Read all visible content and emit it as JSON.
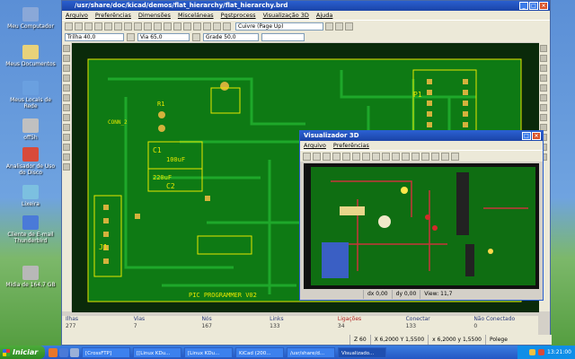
{
  "desktop_icons": [
    {
      "label": "Meu Computador",
      "color": "#8aa8d8"
    },
    {
      "label": "Meus Documentos",
      "color": "#e8d27a"
    },
    {
      "label": "Meus Locais de Rede",
      "color": "#6aa0e0"
    },
    {
      "label": "off5h",
      "color": "#c0c0c0"
    },
    {
      "label": "Analisador de Uso do Disco",
      "color": "#d84a3a"
    },
    {
      "label": "Lixeira",
      "color": "#7cc0e0"
    },
    {
      "label": "Cliente de E-mail Thunderbird",
      "color": "#4a7ad8"
    },
    {
      "label": "Mídia de 164,7 GB",
      "color": "#b8b8b8"
    }
  ],
  "main_window": {
    "title": "/usr/share/doc/kicad/demos/flat_hierarchy/flat_hierarchy.brd",
    "menu": [
      "Arquivo",
      "Preferências",
      "Dimensões",
      "Misceláneas",
      "Pqstprocess",
      "Visualização 3D",
      "Ajuda"
    ],
    "layer_select": "Cuivre (Page Up)",
    "track_select": "Trilha 40,0",
    "via_select": "Via 65,0",
    "grid_select": "Grade 50,0"
  },
  "status": [
    {
      "label": "Ilhas",
      "value": "277"
    },
    {
      "label": "Vias",
      "value": "7"
    },
    {
      "label": "Nós",
      "value": "167"
    },
    {
      "label": "Links",
      "value": "133"
    },
    {
      "label": "Ligações",
      "value": "34",
      "warn": true
    },
    {
      "label": "Conectar",
      "value": "133"
    },
    {
      "label": "Não Conectado",
      "value": "0"
    }
  ],
  "coords": {
    "zoom": "Z 60",
    "abs": "X 6,2000  Y 1,5500",
    "rel": "x 6,2000  y 1,5500",
    "units": "Polege"
  },
  "viewer3d": {
    "title": "Visualizador 3D",
    "menu": [
      "Arquivo",
      "Preferências"
    ],
    "dx": "dx 0,00",
    "dy": "dy 0,00",
    "view": "View: 11,7"
  },
  "pcb_labels": {
    "c1": "C1",
    "c1_val": "100uF",
    "c2": "C2",
    "c2_val": "220uF",
    "p1": "P1",
    "j1": "J1",
    "conn": "CONN_2",
    "banner": "PIC PROGRAMMER  V02",
    "r1": "R1"
  },
  "taskbar": {
    "start": "Iniciar",
    "tasks": [
      "[CrossFTP]",
      "[[Linux KDu...",
      "[Linux KDu...",
      "KiCad (200...",
      "/usr/share/d...",
      "Visualizado..."
    ],
    "clock": "13:21:00"
  }
}
